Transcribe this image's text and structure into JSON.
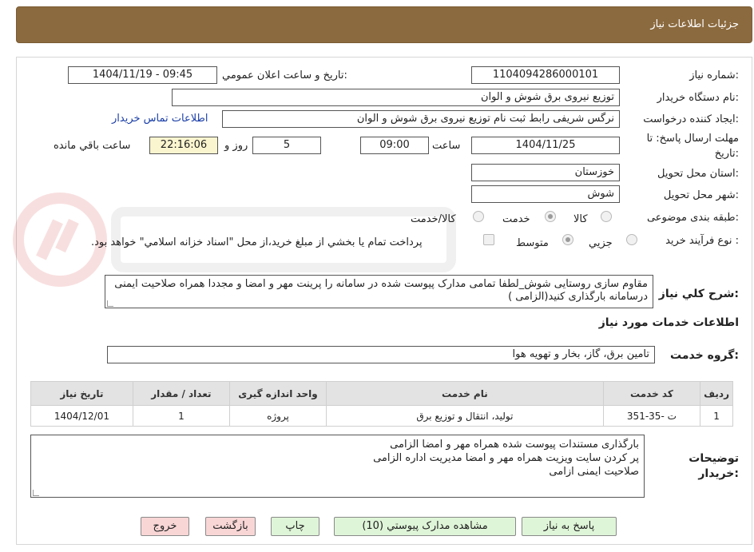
{
  "header": {
    "title": "جزئيات اطلاعات نياز"
  },
  "fields": {
    "need_number_label": "شماره نياز:",
    "need_number": "1104094286000101",
    "announce_label": "تاريخ و ساعت اعلان عمومي:",
    "announce_value": "1404/11/19 - 09:45",
    "buyer_org_label": "نام دستگاه خريدار:",
    "buyer_org": "توزیع نیروی برق شوش و الوان",
    "creator_label": "ايجاد كننده درخواست:",
    "creator": "نرگس شریفی رابط ثبت نام توزیع نیروی برق شوش و الوان",
    "contact_link": "اطلاعات تماس خريدار",
    "deadline_label_1": "مهلت ارسال پاسخ: تا",
    "deadline_label_2": "تاريخ:",
    "deadline_date": "1404/11/25",
    "time_label": "ساعت",
    "deadline_time": "09:00",
    "days_value": "5",
    "days_label": "روز و",
    "remaining_time": "22:16:06",
    "remaining_label": "ساعت باقي مانده",
    "province_label": "استان محل تحويل:",
    "province": "خوزستان",
    "city_label": "شهر محل تحويل:",
    "city": "شوش",
    "category_label": "طبقه بندی موضوعی:",
    "category_options": [
      "كالا",
      "خدمت",
      "كالا/خدمت"
    ],
    "process_label": "نوع فرآيند خريد :",
    "process_options": [
      "جزيي",
      "متوسط"
    ],
    "process_note": "پرداخت تمام يا بخشي از مبلغ خريد،از محل \"اسناد خزانه اسلامي\" خواهد بود."
  },
  "description": {
    "label": "شرح كلي نياز:",
    "text": "مقاوم سازی روستایی شوش_لطفا تمامی مدارک پیوست شده در سامانه را پرینت مهر و امضا و مجددا همراه صلاحیت ایمنی درسامانه بارگذاری کنید(الزامی )"
  },
  "services": {
    "section_title": "اطلاعات خدمات مورد نياز",
    "group_label": "گروه خدمت:",
    "group_value": "تامين برق، گاز، بخار و تهويه هوا",
    "columns": [
      "رديف",
      "كد خدمت",
      "نام خدمت",
      "واحد اندازه گيری",
      "تعداد / مقدار",
      "تاريخ نياز"
    ],
    "rows": [
      {
        "row": "1",
        "code": "ت -35-351",
        "name": "توليد، انتقال و توزيع برق",
        "unit": "پروژه",
        "qty": "1",
        "date": "1404/12/01"
      }
    ]
  },
  "buyer_notes": {
    "label_1": "توضيحات",
    "label_2": "خريدار:",
    "lines": [
      "بارگذاری مستندات پیوست شده همراه مهر و امضا الزامی",
      "پر کردن سایت ویزیت همراه مهر و امضا مدیریت اداره الزامی",
      "صلاحیت ایمنی ازامی"
    ]
  },
  "buttons": {
    "reply": "پاسخ به نياز",
    "attachments": "مشاهده مدارک پيوستي (10)",
    "print": "چاپ",
    "back": "بازگشت",
    "exit": "خروج"
  },
  "colors": {
    "header_bg": "#8b6a3f",
    "green_button": "#dff5d8",
    "red_button": "#f9d6d6",
    "time_box": "#fbf5cf"
  }
}
